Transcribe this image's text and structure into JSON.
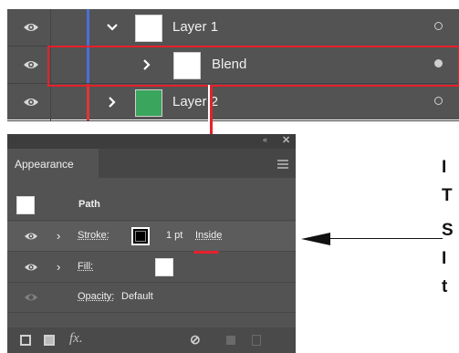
{
  "layers": {
    "rows": [
      {
        "name": "Layer 1",
        "color": "#4a6fd8",
        "thumb": "#ffffff"
      },
      {
        "name": "Blend",
        "color": "#4a6fd8",
        "thumb": "#ffffff"
      },
      {
        "name": "Layer 2",
        "color": "#e03636",
        "thumb": "#3aa55c"
      }
    ]
  },
  "appearance": {
    "tab_label": "Appearance",
    "object_label": "Path",
    "stroke": {
      "label": "Stroke:",
      "weight": "1 pt",
      "align": "Inside",
      "swatch": "#000000"
    },
    "fill": {
      "label": "Fill:",
      "swatch": "#ffffff"
    },
    "opacity": {
      "label": "Opacity:",
      "value": "Default"
    }
  },
  "annotation": {
    "accent": "#e8202a",
    "side_letters": [
      "I",
      "T",
      "S",
      "I",
      "t"
    ]
  }
}
